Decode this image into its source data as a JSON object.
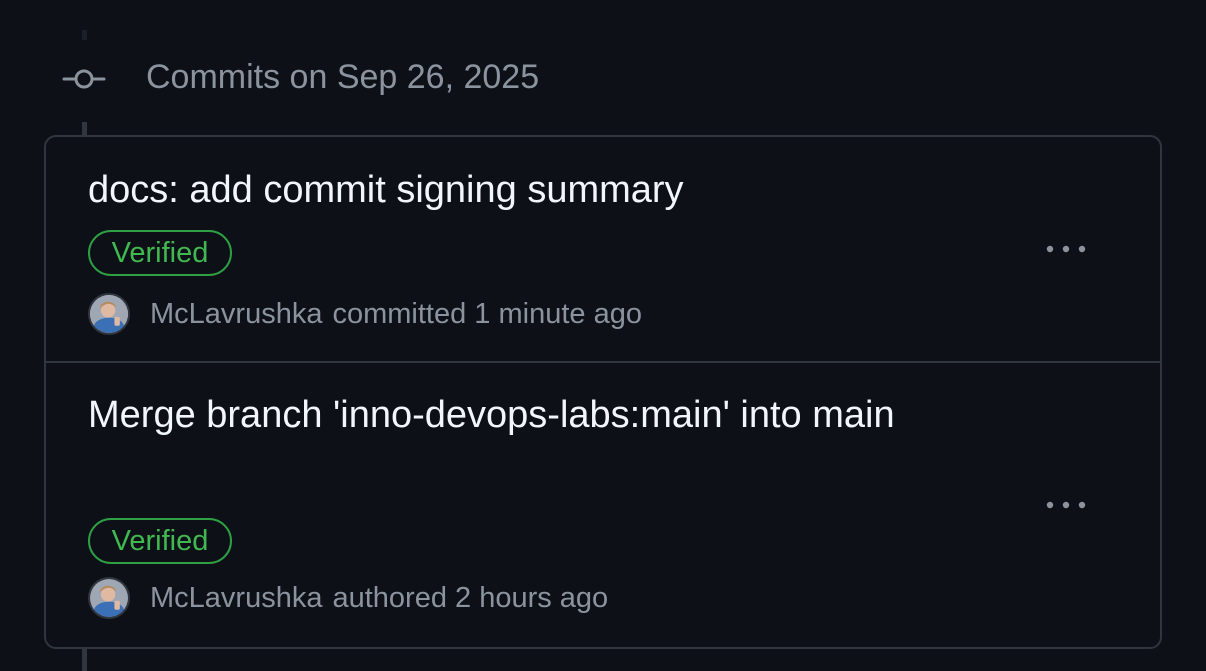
{
  "header": {
    "title": "Commits on Sep 26, 2025"
  },
  "commits": [
    {
      "title": "docs: add commit signing summary",
      "badge": "Verified",
      "author": "McLavrushka",
      "action": "committed 1 minute ago"
    },
    {
      "title": "Merge branch 'inno-devops-labs:main' into main",
      "badge": "Verified",
      "author": "McLavrushka",
      "action": "authored 2 hours ago"
    }
  ],
  "icons": {
    "group": "git-commit-icon",
    "more": "kebab-horizontal-icon",
    "avatar": "user-avatar"
  },
  "colors": {
    "background": "#0d1117",
    "border": "#30363d",
    "text_primary": "#f0f6fc",
    "text_muted": "#8b949e",
    "verified": "#3fb950"
  }
}
